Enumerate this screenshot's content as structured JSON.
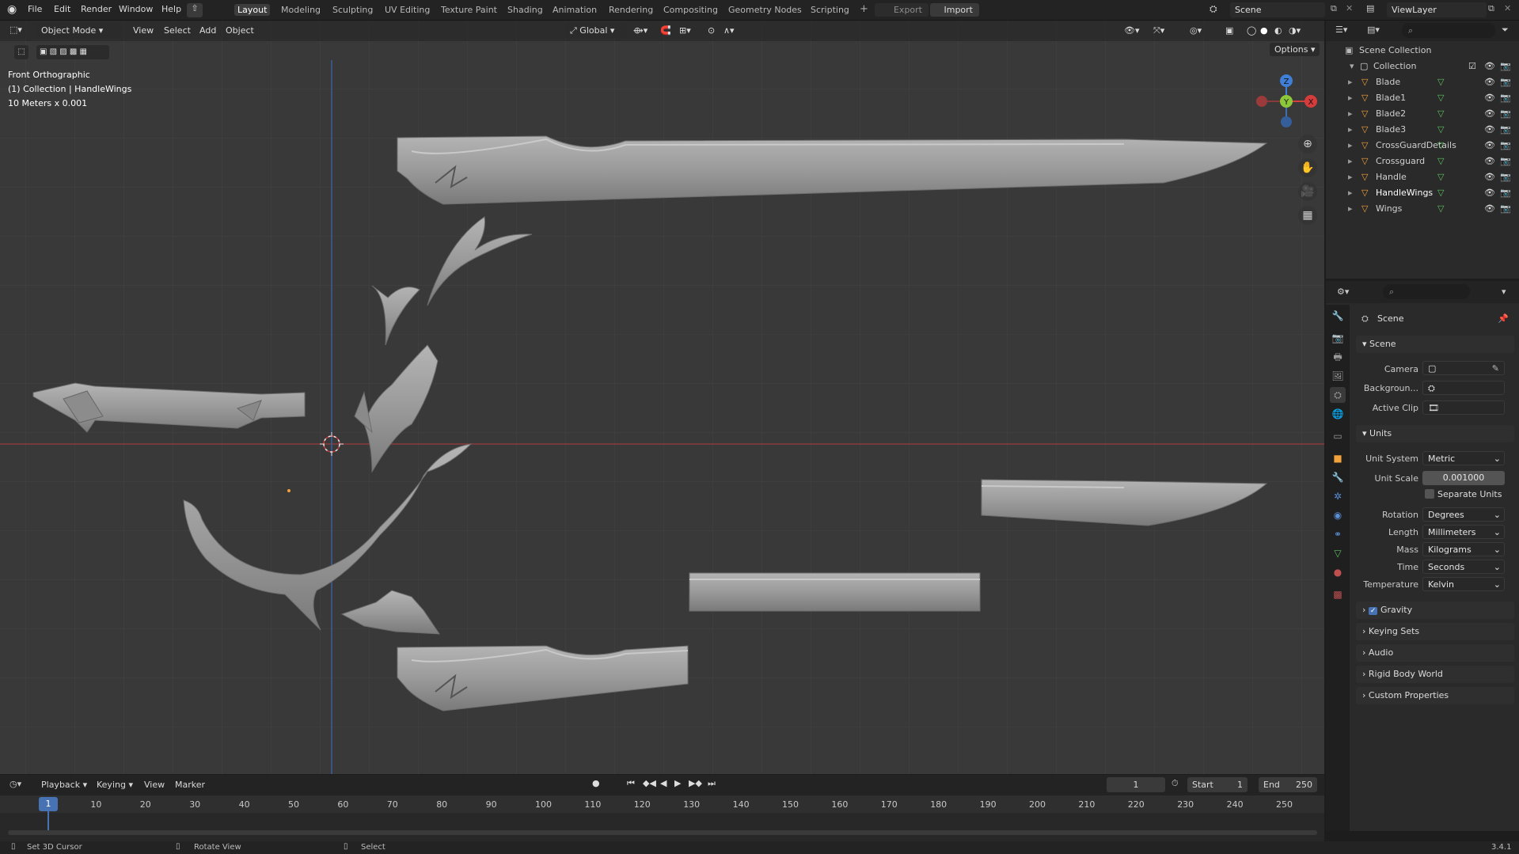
{
  "top_menu": {
    "items": [
      "File",
      "Edit",
      "Render",
      "Window",
      "Help"
    ]
  },
  "workspaces": [
    "Layout",
    "Modeling",
    "Sculpting",
    "UV Editing",
    "Texture Paint",
    "Shading",
    "Animation",
    "Rendering",
    "Compositing",
    "Geometry Nodes",
    "Scripting"
  ],
  "active_workspace": "Layout",
  "export_label": "Export",
  "import_label": "Import",
  "scene_name": "Scene",
  "view_layer": "ViewLayer",
  "viewport": {
    "mode": "Object Mode",
    "menus": [
      "View",
      "Select",
      "Add",
      "Object"
    ],
    "transform_orientation": "Global",
    "options_label": "Options",
    "overlay_lines": [
      "Front Orthographic",
      "(1) Collection | HandleWings",
      "10 Meters x 0.001"
    ]
  },
  "outliner": {
    "root": "Scene Collection",
    "collection": "Collection",
    "objects": [
      "Blade",
      "Blade1",
      "Blade2",
      "Blade3",
      "CrossGuardDetails",
      "Crossguard",
      "Handle",
      "HandleWings",
      "Wings"
    ]
  },
  "properties": {
    "header": "Scene",
    "scene_panel": "Scene",
    "camera_label": "Camera",
    "background_label": "Backgroun...",
    "active_clip_label": "Active Clip",
    "units_panel": "Units",
    "unit_system_label": "Unit System",
    "unit_system": "Metric",
    "unit_scale_label": "Unit Scale",
    "unit_scale": "0.001000",
    "separate_units": "Separate Units",
    "rotation_label": "Rotation",
    "rotation": "Degrees",
    "length_label": "Length",
    "length": "Millimeters",
    "mass_label": "Mass",
    "mass": "Kilograms",
    "time_label": "Time",
    "time": "Seconds",
    "temperature_label": "Temperature",
    "temperature": "Kelvin",
    "collapsed_panels": [
      "Gravity",
      "Keying Sets",
      "Audio",
      "Rigid Body World",
      "Custom Properties"
    ]
  },
  "timeline": {
    "menus": [
      "Playback",
      "Keying",
      "View",
      "Marker"
    ],
    "current_frame": "1",
    "start_label": "Start",
    "start": "1",
    "end_label": "End",
    "end": "250",
    "ticks": [
      "10",
      "20",
      "30",
      "40",
      "50",
      "60",
      "70",
      "80",
      "90",
      "100",
      "110",
      "120",
      "130",
      "140",
      "150",
      "160",
      "170",
      "180",
      "190",
      "200",
      "210",
      "220",
      "230",
      "240",
      "250"
    ]
  },
  "statusbar": {
    "left": "Set 3D Cursor",
    "middle": "Rotate View",
    "right": "Select",
    "version": "3.4.1"
  },
  "colors": {
    "accent": "#4772b3",
    "x_axis": "#d63c3c",
    "y_axis": "#8dc83a",
    "z_axis": "#3f7fd8",
    "viewport_bg": "#393939"
  }
}
